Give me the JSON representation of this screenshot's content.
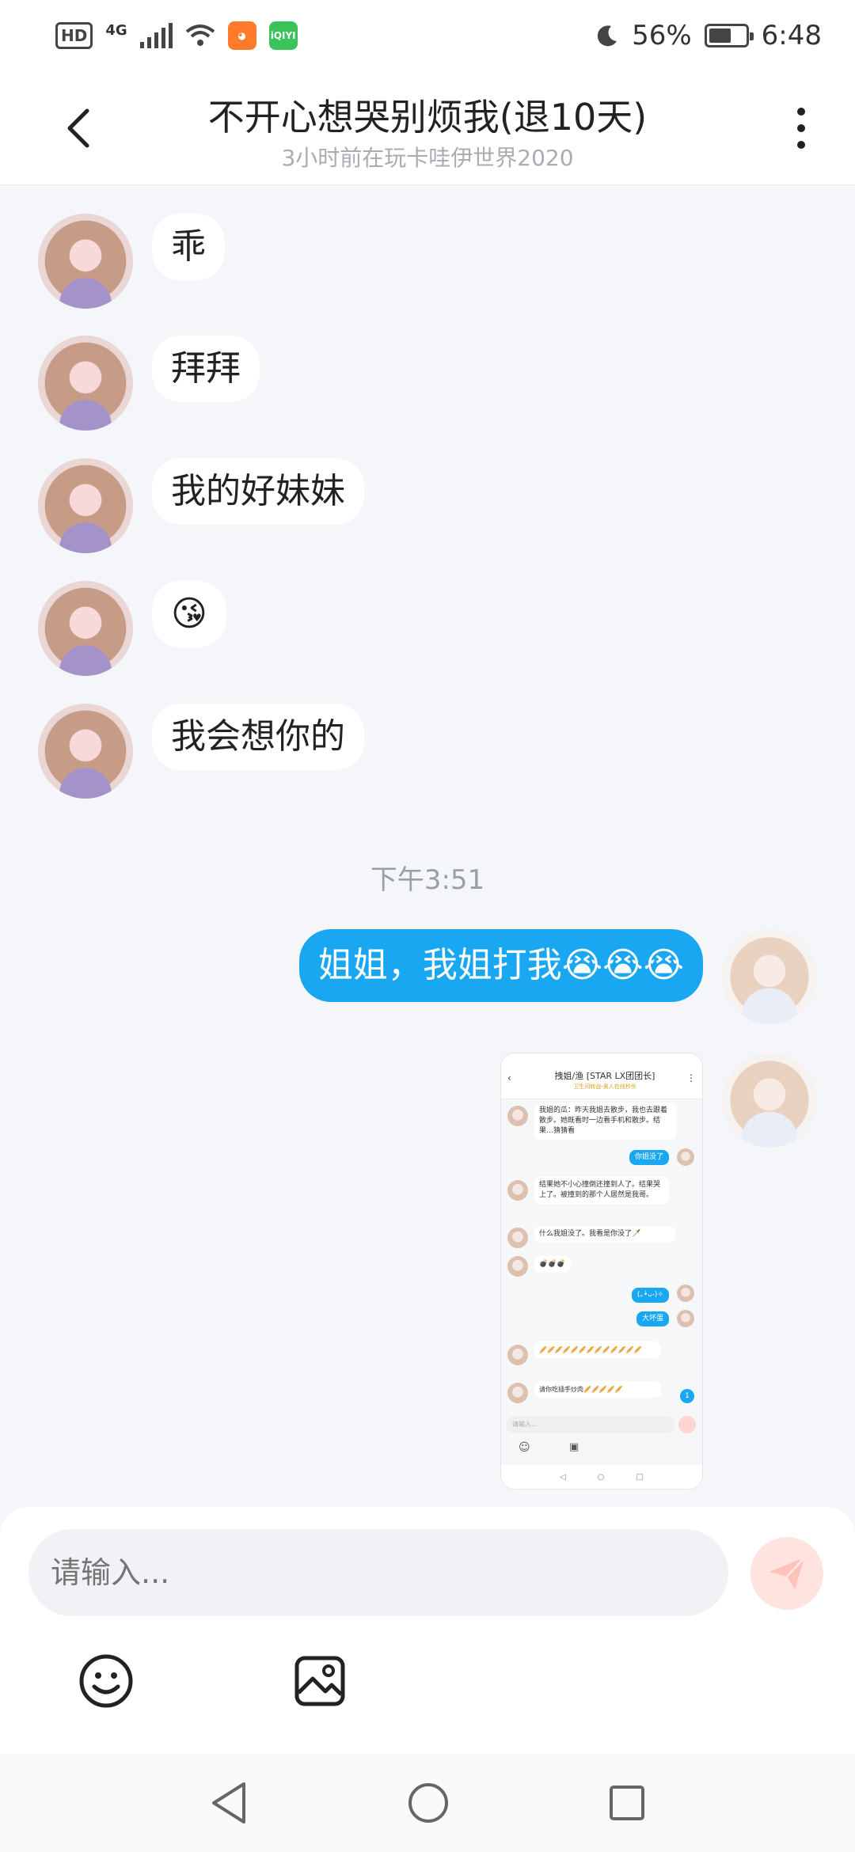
{
  "status_bar": {
    "network": "4G",
    "hd": "HD",
    "apps": [
      "",
      "iQIYI"
    ],
    "battery": "56%",
    "time": "6:48"
  },
  "header": {
    "title": "不开心想哭别烦我(退10天)",
    "subtitle": "3小时前在玩卡哇伊世界2020"
  },
  "messages_left": [
    "乖",
    "拜拜",
    "我的好妹妹",
    "😘",
    "我会想你的"
  ],
  "timestamp": "下午3:51",
  "message_right": "姐姐，我姐打我😭😭😭",
  "shared_screenshot": {
    "title": "拽姐/渔 [STAR LX团团长]",
    "subtitle": "卫生间转战-奥人在线秒杀",
    "rows": [
      "我姐的瓜：昨天我姐去散步，我也去跟着散步。她既看时一边看手机和散步。结果…猜猜看",
      "你姐没了",
      "结果她不小心撞倒还撞到人了。结果哭上了。被撞到的那个人居然是我哥。",
      "什么我姐没了。我看是你没了🗡️",
      "💣💣💣",
      "(｡•̀ᴗ-)✧",
      "大坏蛋",
      "🥖🥖🥖🥖🥖🥖🥖🥖🥖🥖🥖🥖🥖",
      "请你吃插手炒肉🥖🥖🥖🥖🥖"
    ],
    "input_placeholder": "请输入...",
    "badge": "1"
  },
  "input": {
    "placeholder": "请输入..."
  },
  "colors": {
    "accent": "#1aa7f2",
    "background": "#f4f6f9",
    "send_disabled": "#ffe3df"
  },
  "icons": [
    "back-icon",
    "more-icon",
    "send-icon",
    "emoji-icon",
    "image-icon",
    "nav-back-icon",
    "nav-home-icon",
    "nav-recent-icon"
  ]
}
